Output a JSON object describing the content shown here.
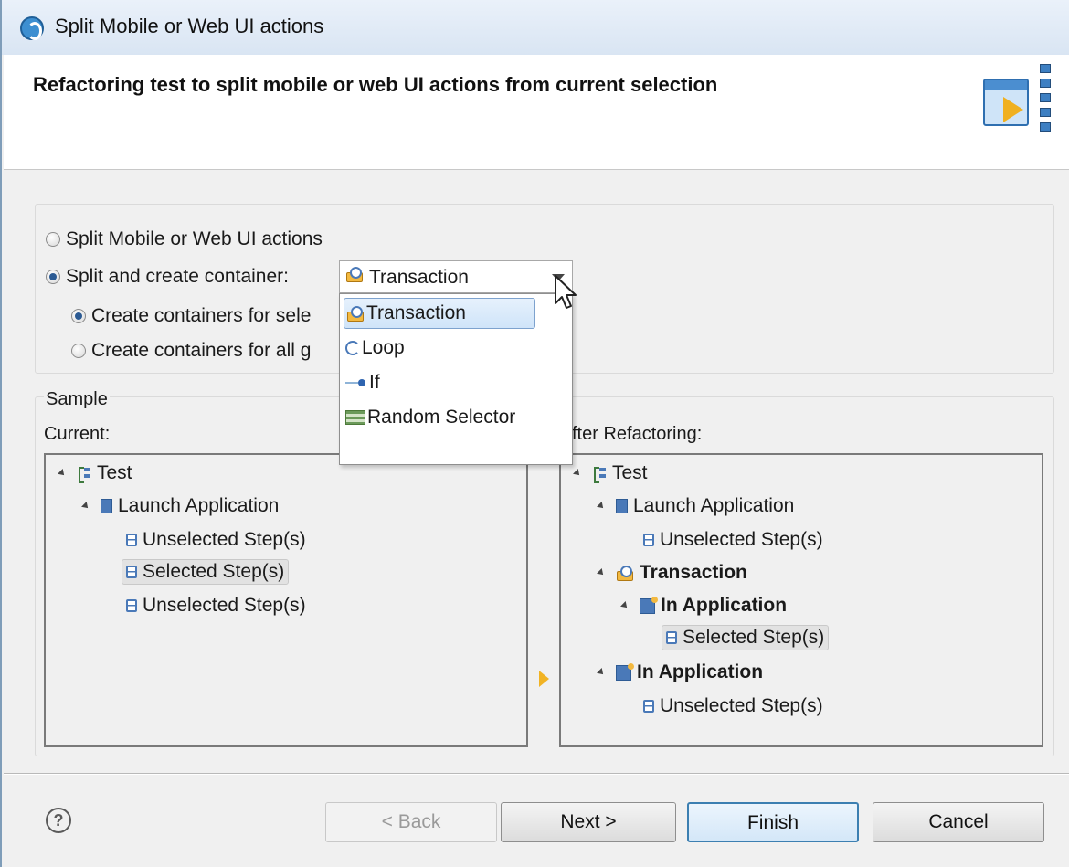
{
  "window": {
    "title": "Split Mobile or Web UI actions"
  },
  "header": {
    "heading": "Refactoring test to split mobile or web UI actions from current selection"
  },
  "options": {
    "split_actions_label": "Split Mobile or Web UI actions",
    "split_container_label": "Split and create container:",
    "create_for_selected_label": "Create containers for sele",
    "create_for_all_label": "Create containers for all g",
    "selected_option": "Split and create container:",
    "selected_sub_option": "Create containers for sele",
    "container_combo": {
      "value": "Transaction",
      "options": [
        {
          "label": "Transaction",
          "icon": "transaction-icon",
          "selected": true
        },
        {
          "label": "Loop",
          "icon": "loop-icon",
          "selected": false
        },
        {
          "label": "If",
          "icon": "if-icon",
          "selected": false
        },
        {
          "label": "Random Selector",
          "icon": "random-selector-icon",
          "selected": false
        }
      ]
    }
  },
  "sample": {
    "group_label": "Sample",
    "current_label": "Current:",
    "after_label": "fter Refactoring:",
    "current_tree": [
      {
        "label": "Test",
        "icon": "test-icon",
        "level": 0,
        "bold": false
      },
      {
        "label": "Launch Application",
        "icon": "application-icon",
        "level": 1,
        "bold": false
      },
      {
        "label": "Unselected Step(s)",
        "icon": "step-icon",
        "level": 2,
        "bold": false
      },
      {
        "label": "Selected Step(s)",
        "icon": "step-icon",
        "level": 2,
        "bold": false,
        "highlighted": true
      },
      {
        "label": "Unselected Step(s)",
        "icon": "step-icon",
        "level": 2,
        "bold": false
      }
    ],
    "after_tree": [
      {
        "label": "Test",
        "icon": "test-icon",
        "level": 0,
        "bold": false
      },
      {
        "label": "Launch Application",
        "icon": "application-icon",
        "level": 1,
        "bold": false
      },
      {
        "label": "Unselected Step(s)",
        "icon": "step-icon",
        "level": 2,
        "bold": false
      },
      {
        "label": "Transaction",
        "icon": "transaction-icon",
        "level": 1,
        "bold": true
      },
      {
        "label": "In Application",
        "icon": "in-application-icon",
        "level": 2,
        "bold": true
      },
      {
        "label": "Selected Step(s)",
        "icon": "step-icon",
        "level": 3,
        "bold": false,
        "highlighted": true
      },
      {
        "label": "In Application",
        "icon": "in-application-icon",
        "level": 1,
        "bold": true
      },
      {
        "label": "Unselected Step(s)",
        "icon": "step-icon",
        "level": 2,
        "bold": false
      }
    ]
  },
  "buttons": {
    "help": "?",
    "back": "< Back",
    "next": "Next >",
    "finish": "Finish",
    "cancel": "Cancel"
  },
  "colors": {
    "accent": "#3c7fb1",
    "selection_bg": "#cfe4f9",
    "window_bg": "#f0f0f0"
  }
}
